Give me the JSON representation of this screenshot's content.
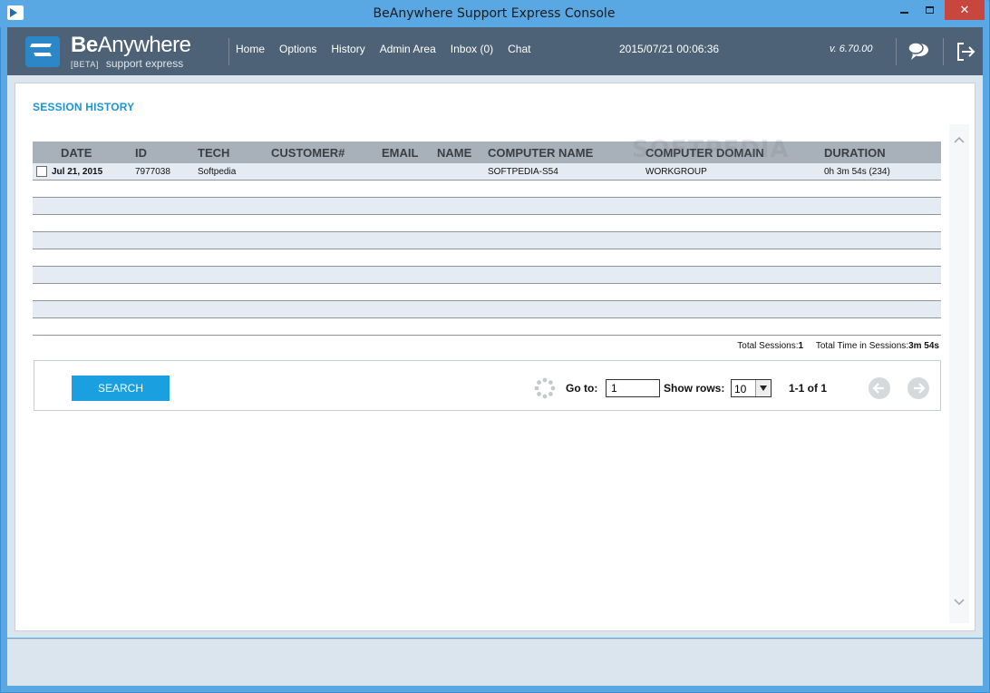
{
  "window": {
    "title": "BeAnywhere Support Express Console",
    "close_glyph": "✕"
  },
  "header": {
    "logo_name_bold": "Be",
    "logo_name_rest": "Anywhere",
    "logo_beta": "[BETA]",
    "logo_sub": "support express",
    "nav": [
      {
        "label": "Home"
      },
      {
        "label": "Options"
      },
      {
        "label": "History"
      },
      {
        "label": "Admin Area"
      },
      {
        "label": "Inbox (0)"
      },
      {
        "label": "Chat"
      }
    ],
    "datetime": "2015/07/21 00:06:36",
    "version": "v. 6.70.00"
  },
  "section": {
    "title": "SESSION HISTORY"
  },
  "table": {
    "columns": [
      "DATE",
      "ID",
      "TECH",
      "CUSTOMER#",
      "EMAIL",
      "NAME",
      "COMPUTER NAME",
      "COMPUTER DOMAIN",
      "DURATION"
    ],
    "rows": [
      {
        "date": "Jul 21, 2015",
        "id": "7977038",
        "tech": "Softpedia",
        "customer": "",
        "email": "",
        "name": "",
        "computer_name": "SOFTPEDIA-S54",
        "computer_domain": "WORKGROUP",
        "duration": "0h 3m 54s (234)"
      }
    ]
  },
  "totals": {
    "sessions_label": "Total Sessions:",
    "sessions_value": "1",
    "time_label": "Total Time in Sessions:",
    "time_value": "3m 54s"
  },
  "controls": {
    "search_label": "SEARCH",
    "goto_label": "Go to:",
    "goto_value": "1",
    "rows_label": "Show rows:",
    "rows_value": "10",
    "page_info": "1-1 of 1"
  },
  "watermark": "SOFTPEDIA",
  "colors": {
    "titlebar": "#5aa8e3",
    "appbar": "#4d6277",
    "accent": "#1aa0e0",
    "close": "#c7463d"
  }
}
